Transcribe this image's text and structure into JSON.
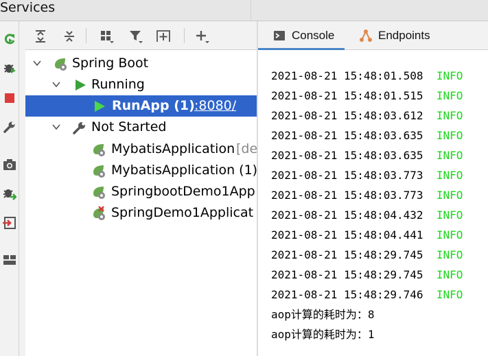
{
  "window": {
    "title": "Services"
  },
  "sidebar": {
    "buttons": [
      {
        "name": "refresh-icon"
      },
      {
        "name": "debug-icon"
      },
      {
        "name": "stop-icon"
      },
      {
        "name": "wrench-icon"
      },
      {
        "name": "camera-icon"
      },
      {
        "name": "attach-debugger-icon"
      },
      {
        "name": "login-icon"
      },
      {
        "name": "layout-icon"
      }
    ]
  },
  "tree_toolbar": {
    "buttons": [
      "expand-all-icon",
      "collapse-all-icon",
      "group-by-icon",
      "filter-icon",
      "new-group-icon",
      "add-service-icon"
    ]
  },
  "tree": {
    "spring_boot": "Spring Boot",
    "running": "Running",
    "runapp_label": "RunApp (1)",
    "runapp_port": ":8080/",
    "not_started": "Not Started",
    "apps": [
      {
        "name": "MybatisApplication",
        "suffix": " [de"
      },
      {
        "name": "MybatisApplication (1)",
        "suffix": ""
      },
      {
        "name": "SpringbootDemo1App",
        "suffix": ""
      },
      {
        "name": "SpringDemo1Applicat",
        "suffix": ""
      }
    ]
  },
  "tabs": {
    "console": "Console",
    "endpoints": "Endpoints"
  },
  "colors": {
    "accent": "#2f65ca",
    "info": "#1bd61b",
    "spring": "#6aa84f"
  },
  "console": {
    "lines": [
      {
        "ts": "2021-08-21 15:48:01.508",
        "level": "INFO"
      },
      {
        "ts": "2021-08-21 15:48:01.515",
        "level": "INFO"
      },
      {
        "ts": "2021-08-21 15:48:03.612",
        "level": "INFO"
      },
      {
        "ts": "2021-08-21 15:48:03.635",
        "level": "INFO"
      },
      {
        "ts": "2021-08-21 15:48:03.635",
        "level": "INFO"
      },
      {
        "ts": "2021-08-21 15:48:03.773",
        "level": "INFO"
      },
      {
        "ts": "2021-08-21 15:48:03.773",
        "level": "INFO"
      },
      {
        "ts": "2021-08-21 15:48:04.432",
        "level": "INFO"
      },
      {
        "ts": "2021-08-21 15:48:04.441",
        "level": "INFO"
      },
      {
        "ts": "2021-08-21 15:48:29.745",
        "level": "INFO"
      },
      {
        "ts": "2021-08-21 15:48:29.745",
        "level": "INFO"
      },
      {
        "ts": "2021-08-21 15:48:29.746",
        "level": "INFO"
      }
    ],
    "aop_lines": [
      "aop计算的耗时为：8",
      "aop计算的耗时为：1"
    ]
  }
}
